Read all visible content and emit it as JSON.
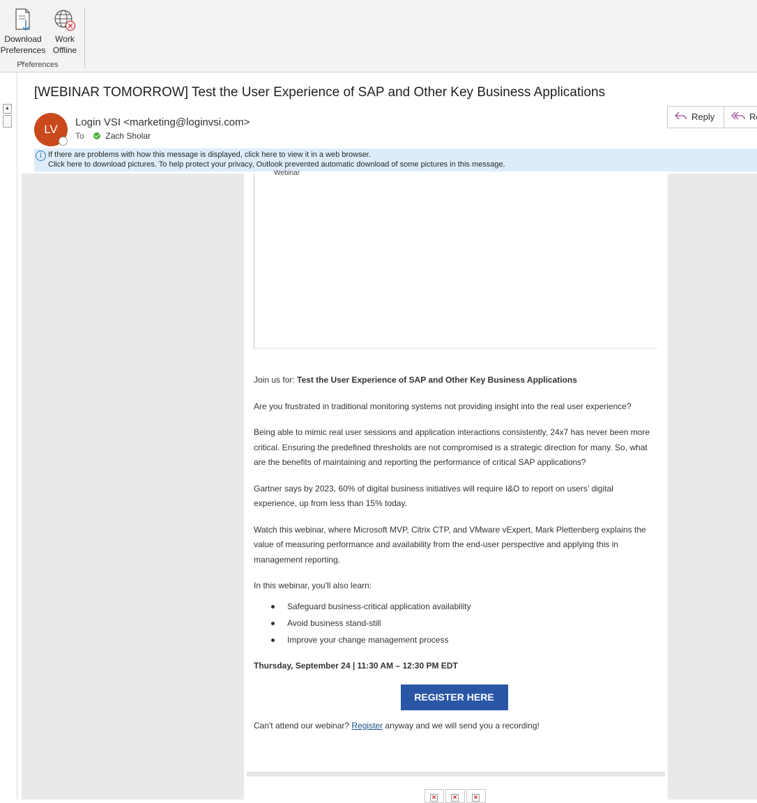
{
  "ribbon": {
    "download_label_1": "Download",
    "download_label_2": "Preferences",
    "download_icon": "download-document-icon",
    "offline_label_1": "Work",
    "offline_label_2": "Offline",
    "offline_icon": "globe-offline-icon",
    "group_label": "Preferences"
  },
  "message": {
    "subject": "[WEBINAR TOMORROW] Test the User Experience of SAP and Other Key Business Applications",
    "avatar_initials": "LV",
    "avatar_color": "#c9491c",
    "sender": "Login VSI <marketing@loginvsi.com>",
    "to_label": "To",
    "recipient": "Zach Sholar",
    "actions": {
      "reply": "Reply",
      "reply_all": "Re"
    },
    "info_line_1": "If there are problems with how this message is displayed, click here to view it in a web browser.",
    "info_line_2": "Click here to download pictures. To help protect your privacy, Outlook prevented automatic download of some pictures in this message."
  },
  "email": {
    "image_alt": "Webinar",
    "join_prefix": "Join us for: ",
    "join_title": "Test the User Experience of SAP and Other Key Business Applications",
    "p1": "Are you frustrated in traditional monitoring systems not providing insight into the real user experience?",
    "p2": "Being able to mimic real user sessions and application interactions consistently, 24x7 has never been more critical. Ensuring the predefined thresholds are not compromised is a strategic direction for many. So, what are the benefits of maintaining and reporting the performance of critical SAP applications?",
    "p3": "Gartner says by 2023, 60% of digital business initiatives will require I&O to report on users’ digital experience, up from less than 15% today.",
    "p4": "Watch this webinar, where Microsoft MVP, Citrix CTP, and VMware vExpert, Mark Plettenberg explains the value of measuring performance and availability from the end-user perspective and applying this in management reporting.",
    "p5": "In this webinar, you'll also learn:",
    "bullets": [
      "Safeguard business-critical application availability",
      "Avoid business stand-still",
      "Improve your change management process"
    ],
    "date_line": "Thursday, September 24 | 11:30 AM – 12:30 PM EDT",
    "register_button": "REGISTER HERE",
    "register_button_color": "#2a56a6",
    "cta_prefix": "Can't attend our webinar? ",
    "cta_link": "Register",
    "cta_suffix": " anyway and we will send you a recording!"
  }
}
